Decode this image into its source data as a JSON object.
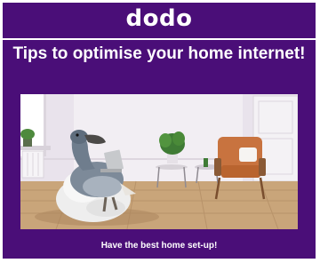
{
  "brand": {
    "logo_text": "dodo"
  },
  "banner": {
    "headline": "Tips to optimise your home internet!",
    "caption": "Have the best home set-up!"
  },
  "colors": {
    "background": "#4a0e78",
    "text": "#ffffff",
    "armchair": "#c8733f",
    "beanbag": "#eeeeee"
  },
  "hero_image": {
    "icons": [
      "dodo-bird-icon",
      "beanbag-icon",
      "laptop-icon",
      "armchair-icon",
      "plant-icon",
      "side-table-icon",
      "window-icon",
      "door-icon"
    ]
  }
}
